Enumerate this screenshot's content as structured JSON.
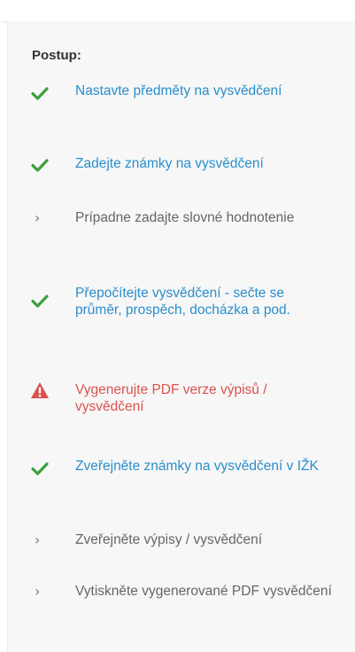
{
  "panel": {
    "title": "Postup:",
    "steps": [
      {
        "label": "Nastavte předměty na vysvědčení",
        "status": "done",
        "icon": "check-icon"
      },
      {
        "label": "Zadejte známky na vysvědčení",
        "status": "done",
        "icon": "check-icon"
      },
      {
        "label": "Prípadne zadajte slovné hodnotenie",
        "status": "pending",
        "icon": "chevron-right-icon"
      },
      {
        "label": "Přepočítejte vysvědčení - sečte se průměr, prospěch, docházka a pod.",
        "status": "done",
        "icon": "check-icon"
      },
      {
        "label": "Vygenerujte PDF verze výpisů / vysvědčení",
        "status": "warning",
        "icon": "warning-icon"
      },
      {
        "label": "Zveřejněte známky na vysvědčení v IŽK",
        "status": "done",
        "icon": "check-icon"
      },
      {
        "label": "Zveřejněte výpisy / vysvědčení",
        "status": "pending",
        "icon": "chevron-right-icon"
      },
      {
        "label": "Vytiskněte vygenerované PDF vysvědčení",
        "status": "pending",
        "icon": "chevron-right-icon"
      }
    ]
  },
  "colors": {
    "done": "#2a8ecc",
    "check": "#3ca03c",
    "pending": "#666666",
    "warning": "#d9534f",
    "panel_bg": "#f7f7f7"
  }
}
